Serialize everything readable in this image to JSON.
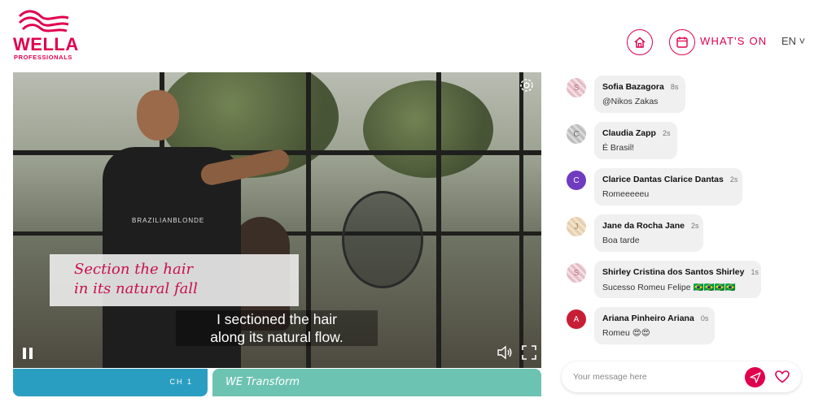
{
  "brand": {
    "name": "WELLA",
    "sub": "PROFESSIONALS",
    "accent": "#e0004d"
  },
  "header": {
    "home_icon": "home-icon",
    "calendar_icon": "calendar-icon",
    "whats_on": "WHAT'S ON",
    "lang": "EN ˅"
  },
  "video": {
    "overlay_line1": "Section the hair",
    "overlay_line2": "in its natural fall",
    "subtitle_line1": "I sectioned the hair",
    "subtitle_line2": "along its natural flow.",
    "apron_text": "BRAZILIANBLONDE",
    "icons": [
      "settings-icon",
      "pause-icon",
      "volume-icon",
      "fullscreen-icon"
    ]
  },
  "channels": [
    {
      "label": "CH 1",
      "color": "#2a9ec0"
    },
    {
      "label": "WE Transform",
      "color": "#6dc3b2"
    }
  ],
  "chat": {
    "messages": [
      {
        "initial": "S",
        "name": "Sofia Bazagora",
        "time": "8s",
        "text": "@Nikos Zakas"
      },
      {
        "initial": "C",
        "name": "Claudia Zapp",
        "time": "2s",
        "text": "É Brasil!"
      },
      {
        "initial": "C",
        "name": "Clarice Dantas Clarice Dantas",
        "time": "2s",
        "text": "Romeeeeeu"
      },
      {
        "initial": "J",
        "name": "Jane da Rocha Jane",
        "time": "2s",
        "text": "Boa tarde"
      },
      {
        "initial": "S",
        "name": "Shirley Cristina dos Santos Shirley",
        "time": "1s",
        "text": "Sucesso Romeu Felipe 🇧🇷🇧🇷🇧🇷🇧🇷"
      },
      {
        "initial": "A",
        "name": "Ariana Pinheiro Ariana",
        "time": "0s",
        "text": "Romeu 😍😍"
      }
    ],
    "composer_placeholder": "Your message here",
    "send_icon": "send-icon",
    "heart_icon": "heart-icon"
  }
}
